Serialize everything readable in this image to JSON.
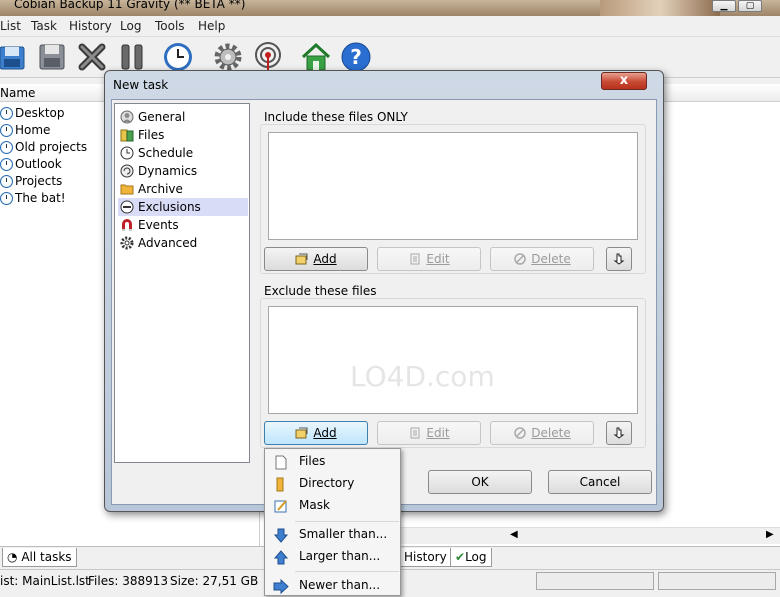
{
  "app": {
    "title": "Cobian Backup 11 Gravity (** BETA **)"
  },
  "menu": [
    "List",
    "Task",
    "History",
    "Log",
    "Tools",
    "Help"
  ],
  "toolbar": {
    "icons": [
      "backup-icon",
      "save-icon",
      "stop-icon",
      "pause-icon",
      "clock-icon",
      "settings-icon",
      "antenna-icon",
      "home-icon",
      "help-icon"
    ]
  },
  "list": {
    "header": "Name",
    "tasks": [
      "Desktop",
      "Home",
      "Old projects",
      "Outlook",
      "Projects",
      "The bat!"
    ]
  },
  "bottom_tabs": {
    "all_tasks": "All tasks",
    "history": "History",
    "log": "Log"
  },
  "status": {
    "list": "ist: MainList.lst",
    "files": "Files: 388913",
    "size": "Size: 27,51 GB"
  },
  "dialog": {
    "title": "New task",
    "close": "x",
    "categories": [
      "General",
      "Files",
      "Schedule",
      "Dynamics",
      "Archive",
      "Exclusions",
      "Events",
      "Advanced"
    ],
    "selected_category": "Exclusions",
    "include_label": "Include these files ONLY",
    "exclude_label": "Exclude these files",
    "add": "Add",
    "edit": "Edit",
    "delete": "Delete",
    "ok": "OK",
    "cancel": "Cancel"
  },
  "popup_menu": [
    "Files",
    "Directory",
    "Mask",
    "Smaller than...",
    "Larger than...",
    "Newer than..."
  ],
  "watermark": "LO4D.com"
}
